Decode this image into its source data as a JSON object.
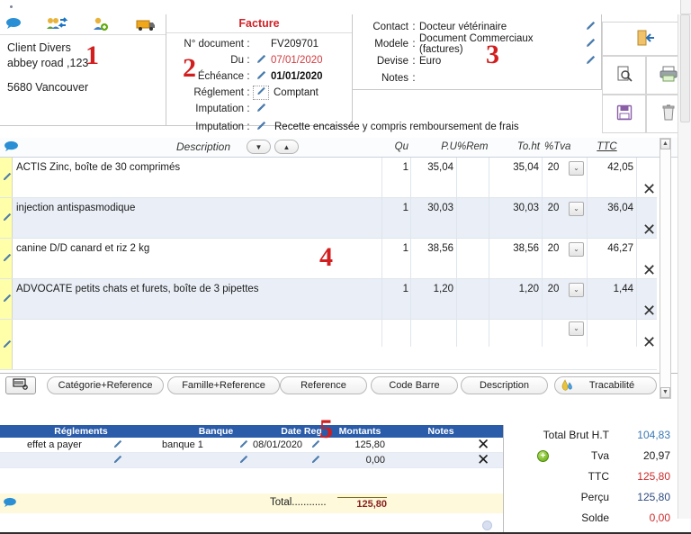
{
  "client": {
    "marker": "1",
    "icons": [
      "comment-bubble-icon",
      "switch-client-icon",
      "add-client-icon",
      "delivery-truck-icon"
    ],
    "name": "Client Divers",
    "address": "abbey road ,123",
    "city": "5680 Vancouver"
  },
  "facture": {
    "marker": "2",
    "title": "Facture",
    "rows": [
      {
        "label": "N° document",
        "colon": ":",
        "value": "FV209701",
        "style": "plain",
        "pencil": false
      },
      {
        "label": "Du",
        "colon": ":",
        "value": "07/01/2020",
        "style": "red",
        "pencil": true
      },
      {
        "label": "Échéance",
        "colon": ":",
        "value": "01/01/2020",
        "style": "bold",
        "pencil": true
      },
      {
        "label": "Réglement",
        "colon": ":",
        "value": "Comptant",
        "style": "plain",
        "pencil": true,
        "pencil_boxed": true
      },
      {
        "label": "Imputation",
        "colon": ":",
        "value": "",
        "style": "plain",
        "pencil": true
      }
    ],
    "imputation_label": "Imputation",
    "imputation_value": "Recette encaissée y compris remboursement de frais"
  },
  "contact": {
    "marker": "3",
    "rows": [
      {
        "label": "Contact",
        "colon": ":",
        "value": "Docteur vétérinaire",
        "pencil": true
      },
      {
        "label": "Modele",
        "colon": ":",
        "value": "Document Commerciaux (factures)",
        "pencil": true
      },
      {
        "label": "Devise",
        "colon": ":",
        "value": "Euro",
        "pencil": true
      },
      {
        "label": "Notes",
        "colon": ":",
        "value": "",
        "pencil": false
      }
    ]
  },
  "toolbar": {
    "exit": "exit-door-icon",
    "preview": "print-preview-icon",
    "print": "printer-icon",
    "save": "save-floppy-icon",
    "delete": "trash-icon"
  },
  "lines": {
    "marker": "4",
    "bubble_icon": "comment-bubble-icon",
    "headers": {
      "description": "Description",
      "qu": "Qu",
      "pu": "P.U",
      "rem": "%Rem",
      "toht": "To.ht",
      "tva": "%Tva",
      "ttc": "TTC"
    },
    "sort_down": "▼",
    "sort_up": "▲",
    "rows": [
      {
        "description": "ACTIS Zinc, boîte de 30 comprimés",
        "qu": "1",
        "pu": "35,04",
        "rem": "",
        "toht": "35,04",
        "tva": "20",
        "ttc": "42,05"
      },
      {
        "description": "injection antispasmodique",
        "qu": "1",
        "pu": "30,03",
        "rem": "",
        "toht": "30,03",
        "tva": "20",
        "ttc": "36,04"
      },
      {
        "description": "canine D/D canard et riz 2 kg",
        "qu": "1",
        "pu": "38,56",
        "rem": "",
        "toht": "38,56",
        "tva": "20",
        "ttc": "46,27"
      },
      {
        "description": "ADVOCATE petits chats et furets, boîte de 3 pipettes",
        "qu": "1",
        "pu": "1,20",
        "rem": "",
        "toht": "1,20",
        "tva": "20",
        "ttc": "1,44"
      },
      {
        "description": "",
        "qu": "",
        "pu": "",
        "rem": "",
        "toht": "",
        "tva": "",
        "ttc": ""
      }
    ],
    "delete_glyph": "✕"
  },
  "search_buttons": {
    "scan_icon": "barcode-scanner-icon",
    "items": [
      "Catégorie+Reference",
      "Famille+Reference",
      "Reference",
      "Code Barre",
      "Description",
      "Tracabilité"
    ],
    "tracabilite_icon": "tracability-icon"
  },
  "payments": {
    "marker": "5",
    "headers": [
      "Réglements",
      "Banque",
      "Date Reg",
      "Montants",
      "Notes"
    ],
    "rows": [
      {
        "reglement": "effet a payer",
        "banque": "banque 1",
        "date": "08/01/2020",
        "montant": "125,80",
        "notes": ""
      },
      {
        "reglement": "",
        "banque": "",
        "date": "",
        "montant": "0,00",
        "notes": ""
      }
    ],
    "total_label": "Total............",
    "total_value": "125,80",
    "bubble_icon": "comment-bubble-icon",
    "delete_glyph": "✕"
  },
  "totals": {
    "rows": [
      {
        "label": "Total Brut H.T",
        "value": "104,83",
        "color": "blue",
        "plus": false
      },
      {
        "label": "Tva",
        "value": "20,97",
        "color": "dark",
        "plus": true
      },
      {
        "label": "TTC",
        "value": "125,80",
        "color": "red",
        "plus": false
      },
      {
        "label": "Perçu",
        "value": "125,80",
        "color": "navy",
        "plus": false
      },
      {
        "label": "Solde",
        "value": "0,00",
        "color": "red",
        "plus": false
      }
    ],
    "plus_glyph": "+"
  }
}
